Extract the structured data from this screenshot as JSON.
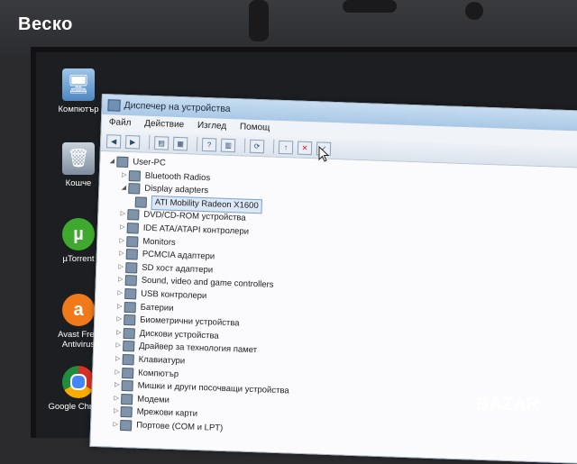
{
  "seller_logo": "Веско",
  "desktop": {
    "icons": [
      {
        "label": "Компютър",
        "name": "computer-icon"
      },
      {
        "label": "Кошче",
        "name": "recycle-bin-icon"
      },
      {
        "label": "µTorrent",
        "name": "utorrent-icon"
      },
      {
        "label": "Avast Free Antivirus",
        "name": "avast-icon"
      },
      {
        "label": "Google Chrome",
        "name": "chrome-icon"
      }
    ]
  },
  "window": {
    "title": "Диспечер на устройства",
    "menu": [
      "Файл",
      "Действие",
      "Изглед",
      "Помощ"
    ]
  },
  "tree": {
    "root": "User-PC",
    "items": [
      {
        "label": "Bluetooth Radios",
        "expanded": false
      },
      {
        "label": "Display adapters",
        "expanded": true
      },
      {
        "label": "ATI Mobility Radeon X1600",
        "child": true,
        "selected": true
      },
      {
        "label": "DVD/CD-ROM устройства",
        "expanded": false
      },
      {
        "label": "IDE ATA/ATAPI контролери",
        "expanded": false
      },
      {
        "label": "Monitors",
        "expanded": false
      },
      {
        "label": "PCMCIA адаптери",
        "expanded": false
      },
      {
        "label": "SD хост адаптери",
        "expanded": false
      },
      {
        "label": "Sound, video and game controllers",
        "expanded": false
      },
      {
        "label": "USB контролери",
        "expanded": false
      },
      {
        "label": "Батерии",
        "expanded": false
      },
      {
        "label": "Биометрични устройства",
        "expanded": false
      },
      {
        "label": "Дискови устройства",
        "expanded": false
      },
      {
        "label": "Драйвер за технология памет",
        "expanded": false
      },
      {
        "label": "Клавиатури",
        "expanded": false
      },
      {
        "label": "Компютър",
        "expanded": false
      },
      {
        "label": "Мишки и други посочващи устройства",
        "expanded": false
      },
      {
        "label": "Модеми",
        "expanded": false
      },
      {
        "label": "Мрежови карти",
        "expanded": false
      },
      {
        "label": "Портове (COM и LPT)",
        "expanded": false
      }
    ]
  },
  "watermark": "BAZAR"
}
